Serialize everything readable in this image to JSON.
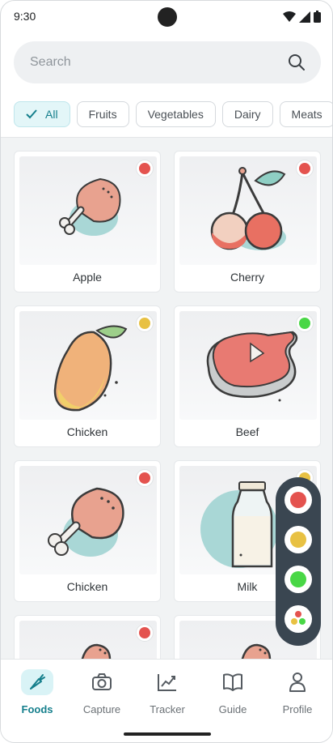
{
  "status_bar": {
    "time": "9:30"
  },
  "search": {
    "placeholder": "Search"
  },
  "chips": [
    {
      "label": "All",
      "active": true
    },
    {
      "label": "Fruits"
    },
    {
      "label": "Vegetables"
    },
    {
      "label": "Dairy"
    },
    {
      "label": "Meats"
    }
  ],
  "foods": [
    {
      "name": "Apple",
      "status": "red",
      "image": "chicken-leg"
    },
    {
      "name": "Cherry",
      "status": "red",
      "image": "cherry"
    },
    {
      "name": "Chicken",
      "status": "yellow",
      "image": "mango"
    },
    {
      "name": "Beef",
      "status": "green",
      "image": "steak"
    },
    {
      "name": "Chicken",
      "status": "red",
      "image": "chicken-leg"
    },
    {
      "name": "Milk",
      "status": "yellow",
      "image": "milk-bottle"
    },
    {
      "name": "",
      "status": "red",
      "image": "chicken-leg"
    },
    {
      "name": "",
      "status": "",
      "image": "chicken-leg"
    }
  ],
  "filter_menu": [
    "red",
    "yellow",
    "green",
    "mixed"
  ],
  "nav": [
    {
      "label": "Foods",
      "icon": "carrot-icon",
      "active": true
    },
    {
      "label": "Capture",
      "icon": "camera-icon"
    },
    {
      "label": "Tracker",
      "icon": "chart-icon"
    },
    {
      "label": "Guide",
      "icon": "book-icon"
    },
    {
      "label": "Profile",
      "icon": "person-icon"
    }
  ],
  "colors": {
    "red": "#e4534f",
    "yellow": "#e8c143",
    "green": "#49d746",
    "accent": "#157f8c"
  }
}
